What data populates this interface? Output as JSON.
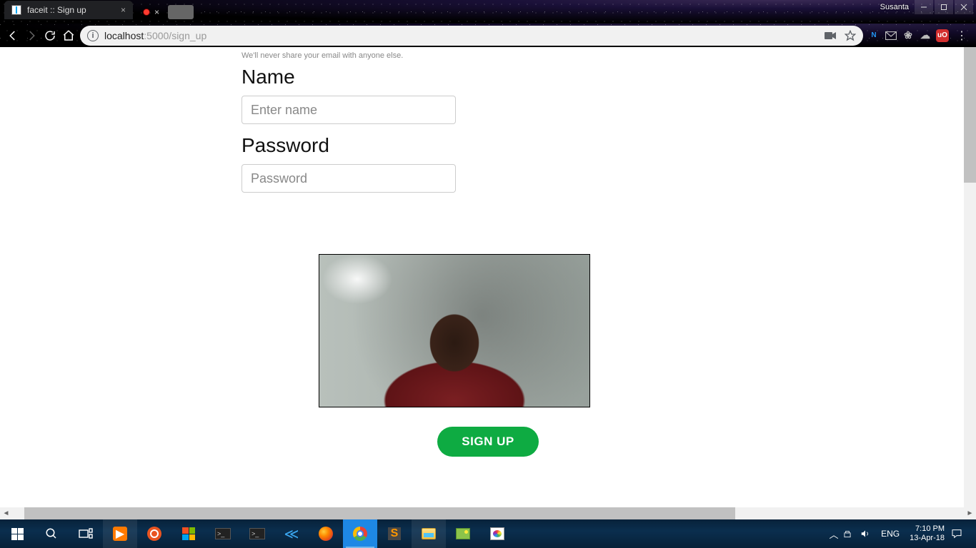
{
  "window": {
    "user": "Susanta"
  },
  "browser": {
    "tab_title": "faceit :: Sign up",
    "url_host": "localhost",
    "url_path": ":5000/sign_up"
  },
  "page": {
    "email_helper": "We'll never share your email with anyone else.",
    "name_label": "Name",
    "name_placeholder": "Enter name",
    "password_label": "Password",
    "password_placeholder": "Password",
    "signup_button": "SIGN UP"
  },
  "taskbar": {
    "lang": "ENG",
    "time": "7:10 PM",
    "date": "13-Apr-18"
  }
}
